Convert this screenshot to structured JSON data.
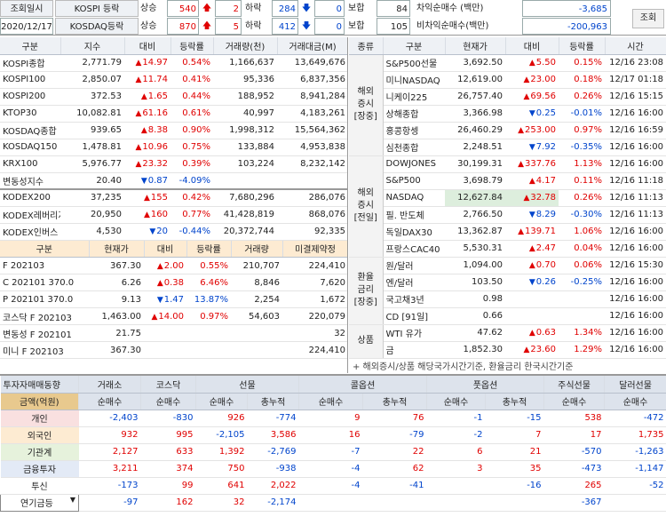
{
  "top": {
    "title_label": "조회일시",
    "date": "2020/12/17",
    "rows": [
      {
        "market": "KOSPI 등락",
        "up_label": "상승",
        "up_count": "540",
        "up_limit": "2",
        "down_label": "하락",
        "down_count": "284",
        "down_limit": "0",
        "flat_label": "보합",
        "flat_count": "84",
        "net_label": "차익순매수 (백만)",
        "net_value": "-3,685"
      },
      {
        "market": "KOSDAQ등락",
        "up_label": "상승",
        "up_count": "870",
        "up_limit": "5",
        "down_label": "하락",
        "down_count": "412",
        "down_limit": "0",
        "flat_label": "보합",
        "flat_count": "105",
        "net_label": "비차익순매수(백만)",
        "net_value": "-200,963"
      }
    ],
    "query_button": "조회"
  },
  "index_table": {
    "headers": [
      "구분",
      "지수",
      "대비",
      "등락률",
      "거래량(천)",
      "거래대금(M)"
    ],
    "rows": [
      {
        "name": "KOSPI종합",
        "value": "2,771.79",
        "dir": "up",
        "change": "14.97",
        "rate": "0.54%",
        "volume": "1,166,637",
        "amount": "13,649,676"
      },
      {
        "name": "KOSPI100",
        "value": "2,850.07",
        "dir": "up",
        "change": "11.74",
        "rate": "0.41%",
        "volume": "95,336",
        "amount": "6,837,356"
      },
      {
        "name": "KOSPI200",
        "value": "372.53",
        "dir": "up",
        "change": "1.65",
        "rate": "0.44%",
        "volume": "188,952",
        "amount": "8,941,284"
      },
      {
        "name": "KTOP30",
        "value": "10,082.81",
        "dir": "up",
        "change": "61.16",
        "rate": "0.61%",
        "volume": "40,997",
        "amount": "4,183,261"
      },
      {
        "name": "KOSDAQ종합",
        "value": "939.65",
        "dir": "up",
        "change": "8.38",
        "rate": "0.90%",
        "volume": "1,998,312",
        "amount": "15,564,362"
      },
      {
        "name": "KOSDAQ150",
        "value": "1,478.81",
        "dir": "up",
        "change": "10.96",
        "rate": "0.75%",
        "volume": "133,884",
        "amount": "4,953,838"
      },
      {
        "name": "KRX100",
        "value": "5,976.77",
        "dir": "up",
        "change": "23.32",
        "rate": "0.39%",
        "volume": "103,224",
        "amount": "8,232,142"
      },
      {
        "name": "변동성지수",
        "value": "20.40",
        "dir": "down",
        "change": "0.87",
        "rate": "-4.09%",
        "volume": "",
        "amount": ""
      }
    ]
  },
  "etf_table": {
    "rows": [
      {
        "name": "KODEX200",
        "value": "37,235",
        "dir": "up",
        "change": "155",
        "rate": "0.42%",
        "volume": "7,680,296",
        "amount": "286,076"
      },
      {
        "name": "KODEX레버리지",
        "value": "20,950",
        "dir": "up",
        "change": "160",
        "rate": "0.77%",
        "volume": "41,428,819",
        "amount": "868,076"
      },
      {
        "name": "KODEX인버스",
        "value": "4,530",
        "dir": "down",
        "change": "20",
        "rate": "-0.44%",
        "volume": "20,372,744",
        "amount": "92,335"
      }
    ]
  },
  "futures_table": {
    "headers": [
      "구분",
      "현재가",
      "대비",
      "등락률",
      "거래량",
      "미결제약정"
    ],
    "rows": [
      {
        "name": "F 202103",
        "value": "367.30",
        "dir": "up",
        "change": "2.00",
        "rate": "0.55%",
        "volume": "210,707",
        "oi": "224,410"
      },
      {
        "name": "C 202101 370.0",
        "value": "6.26",
        "dir": "up",
        "change": "0.38",
        "rate": "6.46%",
        "volume": "8,846",
        "oi": "7,620"
      },
      {
        "name": "P 202101 370.0",
        "value": "9.13",
        "dir": "down",
        "change": "1.47",
        "rate": "13.87%",
        "volume": "2,254",
        "oi": "1,672"
      },
      {
        "name": "코스닥 F 202103",
        "value": "1,463.00",
        "dir": "up",
        "change": "14.00",
        "rate": "0.97%",
        "volume": "54,603",
        "oi": "220,079"
      },
      {
        "name": "변동성 F 202101",
        "value": "21.75",
        "dir": "",
        "change": "",
        "rate": "",
        "volume": "",
        "oi": "32"
      },
      {
        "name": "미니 F 202103",
        "value": "367.30",
        "dir": "",
        "change": "",
        "rate": "",
        "volume": "",
        "oi": "224,410"
      }
    ]
  },
  "overseas": {
    "headers": [
      "종류",
      "구분",
      "현재가",
      "대비",
      "등락률",
      "시간"
    ],
    "groups": [
      {
        "label": "해외\n증시\n[장중]",
        "rows": [
          {
            "name": "S&P500선물",
            "value": "3,692.50",
            "dir": "up",
            "change": "5.50",
            "rate": "0.15%",
            "time": "12/16 23:08"
          },
          {
            "name": "미니NASDAQ",
            "value": "12,619.00",
            "dir": "up",
            "change": "23.00",
            "rate": "0.18%",
            "time": "12/17 01:18"
          },
          {
            "name": "니케이225",
            "value": "26,757.40",
            "dir": "up",
            "change": "69.56",
            "rate": "0.26%",
            "time": "12/16 15:15"
          },
          {
            "name": "상해종합",
            "value": "3,366.98",
            "dir": "down",
            "change": "0.25",
            "rate": "-0.01%",
            "time": "12/16 16:00"
          },
          {
            "name": "홍콩항셍",
            "value": "26,460.29",
            "dir": "up",
            "change": "253.00",
            "rate": "0.97%",
            "time": "12/16 16:59"
          },
          {
            "name": "심천종합",
            "value": "2,248.51",
            "dir": "down",
            "change": "7.92",
            "rate": "-0.35%",
            "time": "12/16 16:00"
          }
        ]
      },
      {
        "label": "해외\n증시\n[전일]",
        "rows": [
          {
            "name": "DOWJONES",
            "value": "30,199.31",
            "dir": "up",
            "change": "337.76",
            "rate": "1.13%",
            "time": "12/16 16:00"
          },
          {
            "name": "S&P500",
            "value": "3,698.79",
            "dir": "up",
            "change": "4.17",
            "rate": "0.11%",
            "time": "12/16 11:18"
          },
          {
            "name": "NASDAQ",
            "value": "12,627.84",
            "dir": "up",
            "change": "32.78",
            "rate": "0.26%",
            "time": "12/16 11:13"
          },
          {
            "name": "필. 반도체",
            "value": "2,766.50",
            "dir": "down",
            "change": "8.29",
            "rate": "-0.30%",
            "time": "12/16 11:13"
          },
          {
            "name": "독일DAX30",
            "value": "13,362.87",
            "dir": "up",
            "change": "139.71",
            "rate": "1.06%",
            "time": "12/16 16:00"
          },
          {
            "name": "프랑스CAC40",
            "value": "5,530.31",
            "dir": "up",
            "change": "2.47",
            "rate": "0.04%",
            "time": "12/16 16:00"
          }
        ]
      },
      {
        "label": "환율\n금리\n[장중]",
        "rows": [
          {
            "name": "원/달러",
            "value": "1,094.00",
            "dir": "up",
            "change": "0.70",
            "rate": "0.06%",
            "time": "12/16 15:30"
          },
          {
            "name": "엔/달러",
            "value": "103.50",
            "dir": "down",
            "change": "0.26",
            "rate": "-0.25%",
            "time": "12/16 16:00"
          },
          {
            "name": "국고채3년",
            "value": "0.98",
            "dir": "",
            "change": "",
            "rate": "",
            "time": "12/16 16:00"
          },
          {
            "name": "CD [91일]",
            "value": "0.66",
            "dir": "",
            "change": "",
            "rate": "",
            "time": "12/16 16:00"
          }
        ]
      },
      {
        "label": "상품",
        "rows": [
          {
            "name": "WTI 유가",
            "value": "47.62",
            "dir": "up",
            "change": "0.63",
            "rate": "1.34%",
            "time": "12/16 16:00"
          },
          {
            "name": "금",
            "value": "1,852.30",
            "dir": "up",
            "change": "23.60",
            "rate": "1.29%",
            "time": "12/16 16:00"
          }
        ]
      }
    ],
    "note": "+ 해외증시/상품 해당국가시간기준, 환율금리 한국시간기준"
  },
  "investors": {
    "title": "투자자매매동향",
    "groups": [
      "거래소",
      "코스닥",
      "선물",
      "콜옵션",
      "풋옵션",
      "주식선물",
      "달러선물"
    ],
    "sub_label": "금액(억원)",
    "subs": [
      "순매수",
      "순매수",
      "순매수",
      "총누적",
      "순매수",
      "총누적",
      "순매수",
      "총누적",
      "순매수",
      "순매수"
    ],
    "rows": [
      {
        "name": "개인",
        "cls": "pink",
        "vals": [
          "-2,403",
          "-830",
          "926",
          "-774",
          "9",
          "76",
          "-1",
          "-15",
          "538",
          "-472"
        ]
      },
      {
        "name": "외국인",
        "cls": "orange",
        "vals": [
          "932",
          "995",
          "-2,105",
          "3,586",
          "16",
          "-79",
          "-2",
          "7",
          "17",
          "1,735"
        ]
      },
      {
        "name": "기관계",
        "cls": "lg",
        "vals": [
          "2,127",
          "633",
          "1,392",
          "-2,769",
          "-7",
          "22",
          "6",
          "21",
          "-570",
          "-1,263"
        ]
      },
      {
        "name": "금융투자",
        "cls": "bl",
        "vals": [
          "3,211",
          "374",
          "750",
          "-938",
          "-4",
          "62",
          "3",
          "35",
          "-473",
          "-1,147"
        ]
      },
      {
        "name": "투신",
        "cls": "",
        "vals": [
          "-173",
          "99",
          "641",
          "2,022",
          "-4",
          "-41",
          "",
          "-16",
          "265",
          "-52"
        ]
      },
      {
        "name": "연기금등",
        "cls": "sel",
        "vals": [
          "-97",
          "162",
          "32",
          "-2,174",
          "",
          "",
          "",
          "",
          "-367",
          ""
        ]
      }
    ]
  },
  "colors": {
    "up": "#e00000",
    "down": "#0044cc"
  }
}
